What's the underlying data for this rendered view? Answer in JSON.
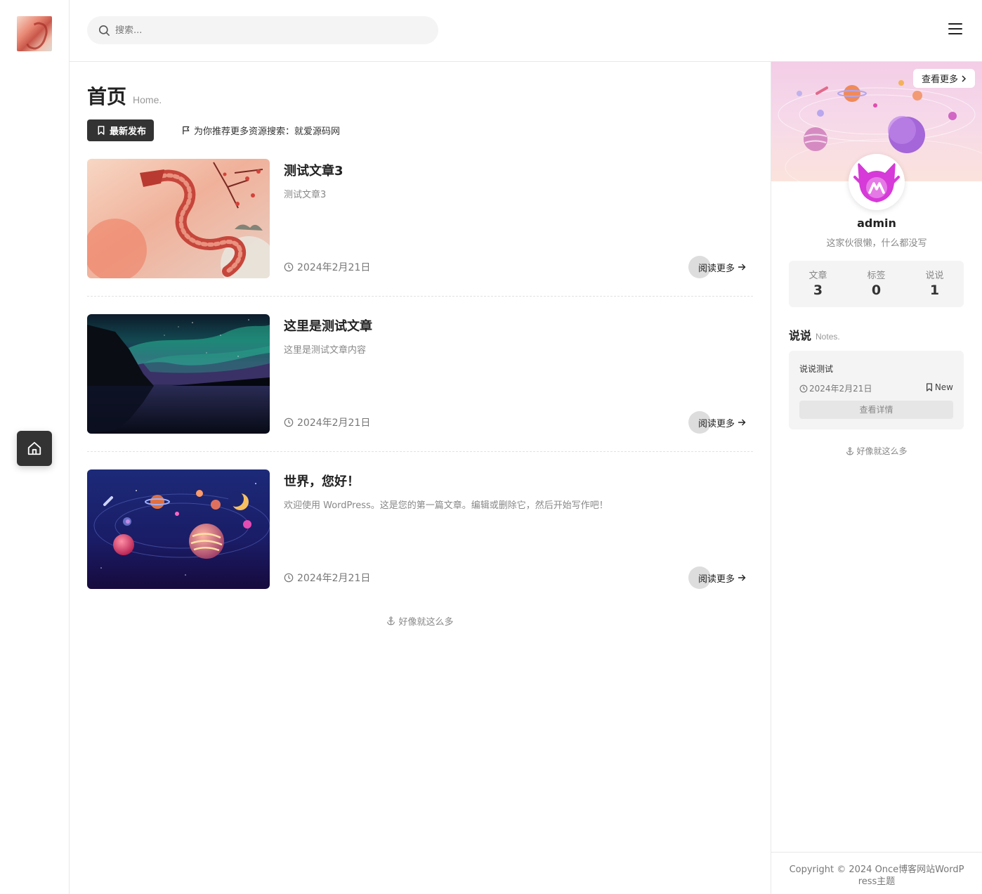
{
  "search": {
    "placeholder": "搜索..."
  },
  "page": {
    "title": "首页",
    "subtitle": "Home."
  },
  "filters": {
    "latest": "最新发布",
    "recommend": "为你推荐更多资源搜索：就爱源码网"
  },
  "posts": [
    {
      "title": "测试文章3",
      "excerpt": "测试文章3",
      "date": "2024年2月21日",
      "read_more": "阅读更多"
    },
    {
      "title": "这里是测试文章",
      "excerpt": "这里是测试文章内容",
      "date": "2024年2月21日",
      "read_more": "阅读更多"
    },
    {
      "title": "世界，您好！",
      "excerpt": "欢迎使用 WordPress。这是您的第一篇文章。编辑或删除它，然后开始写作吧！",
      "date": "2024年2月21日",
      "read_more": "阅读更多"
    }
  ],
  "main_endnote": "好像就这么多",
  "sidebar": {
    "more_button": "查看更多",
    "author": {
      "name": "admin",
      "bio": "这家伙很懒，什么都没写"
    },
    "stats": [
      {
        "label": "文章",
        "value": "3"
      },
      {
        "label": "标签",
        "value": "0"
      },
      {
        "label": "说说",
        "value": "1"
      }
    ],
    "notes": {
      "title": "说说",
      "subtitle": "Notes.",
      "items": [
        {
          "text": "说说测试",
          "date": "2024年2月21日",
          "badge": "New",
          "detail_button": "查看详情"
        }
      ]
    },
    "endnote": "好像就这么多",
    "copyright": "Copyright © 2024 Once博客网站WordPress主题"
  },
  "colors": {
    "accent_dark": "#333333",
    "avatar_brand": "#d63ad8",
    "text_muted": "#888888",
    "panel_bg": "#f4f4f4"
  },
  "icons": {
    "search": "search-icon",
    "menu": "menu-icon",
    "home": "home-icon",
    "bookmark": "bookmark-icon",
    "flag": "flag-icon",
    "clock": "clock-icon",
    "arrow": "arrow-right-icon",
    "anchor": "anchor-icon",
    "chevron": "chevron-right-icon"
  }
}
